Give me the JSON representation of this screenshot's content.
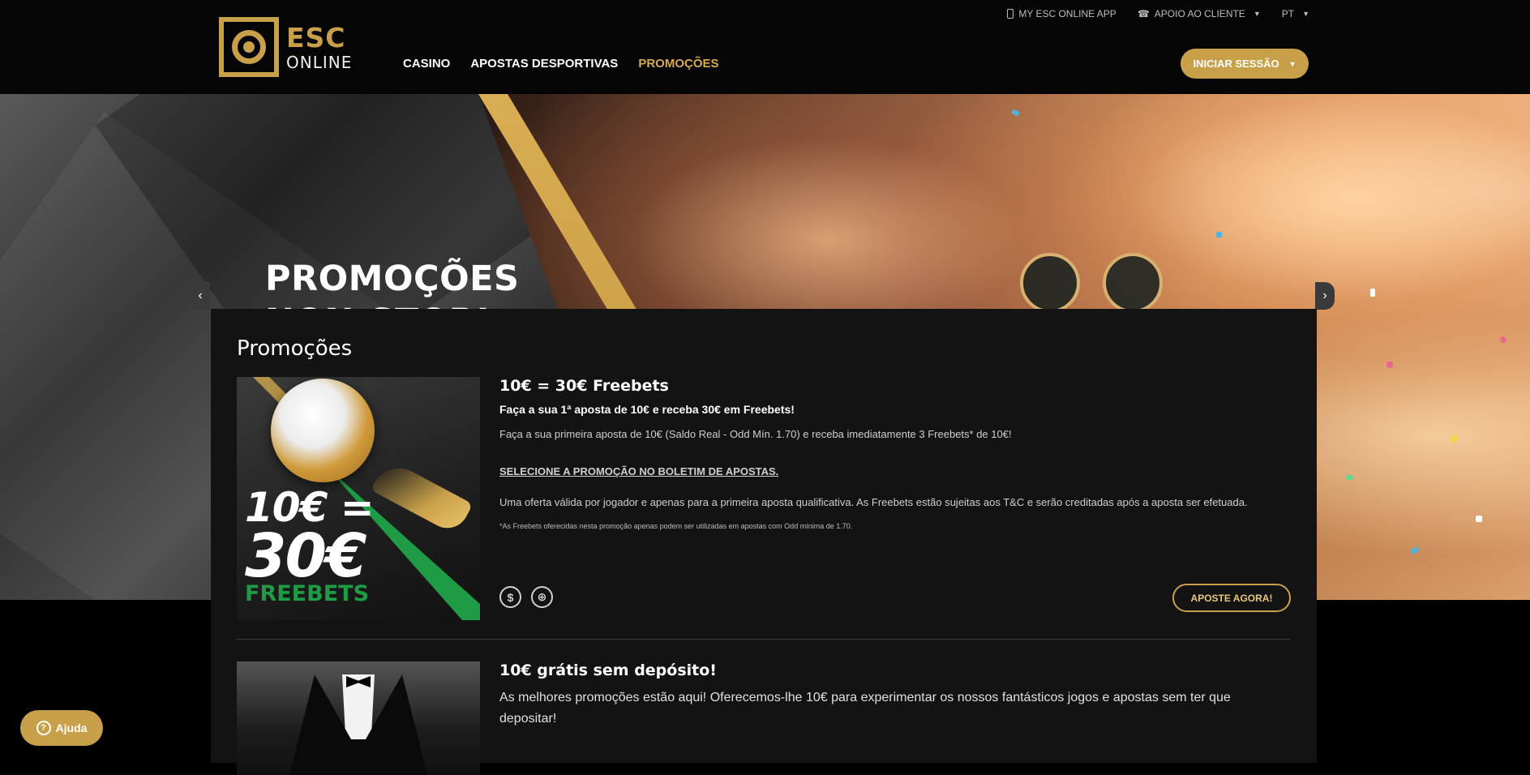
{
  "header": {
    "logo": {
      "line1": "ESC",
      "line2": "ONLINE"
    },
    "nav": [
      {
        "label": "CASINO"
      },
      {
        "label": "APOSTAS DESPORTIVAS"
      },
      {
        "label": "PROMOÇÕES",
        "active": true
      }
    ],
    "top_links": {
      "app": "MY ESC ONLINE APP",
      "support": "APOIO AO CLIENTE",
      "language": "PT"
    },
    "login_label": "INICIAR SESSÃO"
  },
  "hero": {
    "title_line1": "PROMOÇÕES",
    "title_line2": "NON-STOP!",
    "prev_symbol": "‹",
    "next_symbol": "›"
  },
  "promotions": {
    "title": "Promoções",
    "items": [
      {
        "image_text": {
          "l1": "10€ =",
          "l2": "30€",
          "l3": "FREEBETS"
        },
        "heading": "10€ = 30€ Freebets",
        "subheading": "Faça a sua 1ª aposta de 10€ e receba 30€ em Freebets!",
        "paragraph1": "Faça a sua primeira aposta de 10€ (Saldo Real - Odd Mín. 1.70) e receba imediatamente 3 Freebets* de 10€!",
        "link": "SELECIONE A PROMOÇÃO NO BOLETIM DE APOSTAS.",
        "paragraph2": "Uma oferta válida por jogador e apenas para a primeira aposta qualificativa. As Freebets estão sujeitas aos T&C e serão creditadas após a aposta ser efetuada.",
        "footnote": "*As Freebets oferecidas nesta promoção apenas podem ser utilizadas em apostas com Odd mínima de 1.70.",
        "category_icons": [
          "casino-chip-icon",
          "basketball-icon"
        ],
        "cta": "APOSTE AGORA!"
      },
      {
        "heading": "10€ grátis sem depósito!",
        "paragraph1": "As melhores promoções estão aqui! Oferecemos-lhe 10€ para experimentar os nossos fantásticos jogos e apostas sem ter que depositar!"
      }
    ]
  },
  "help": {
    "label": "Ajuda"
  },
  "colors": {
    "gold": "#c9a04a",
    "green": "#1f9a45",
    "panel": "#131313"
  }
}
